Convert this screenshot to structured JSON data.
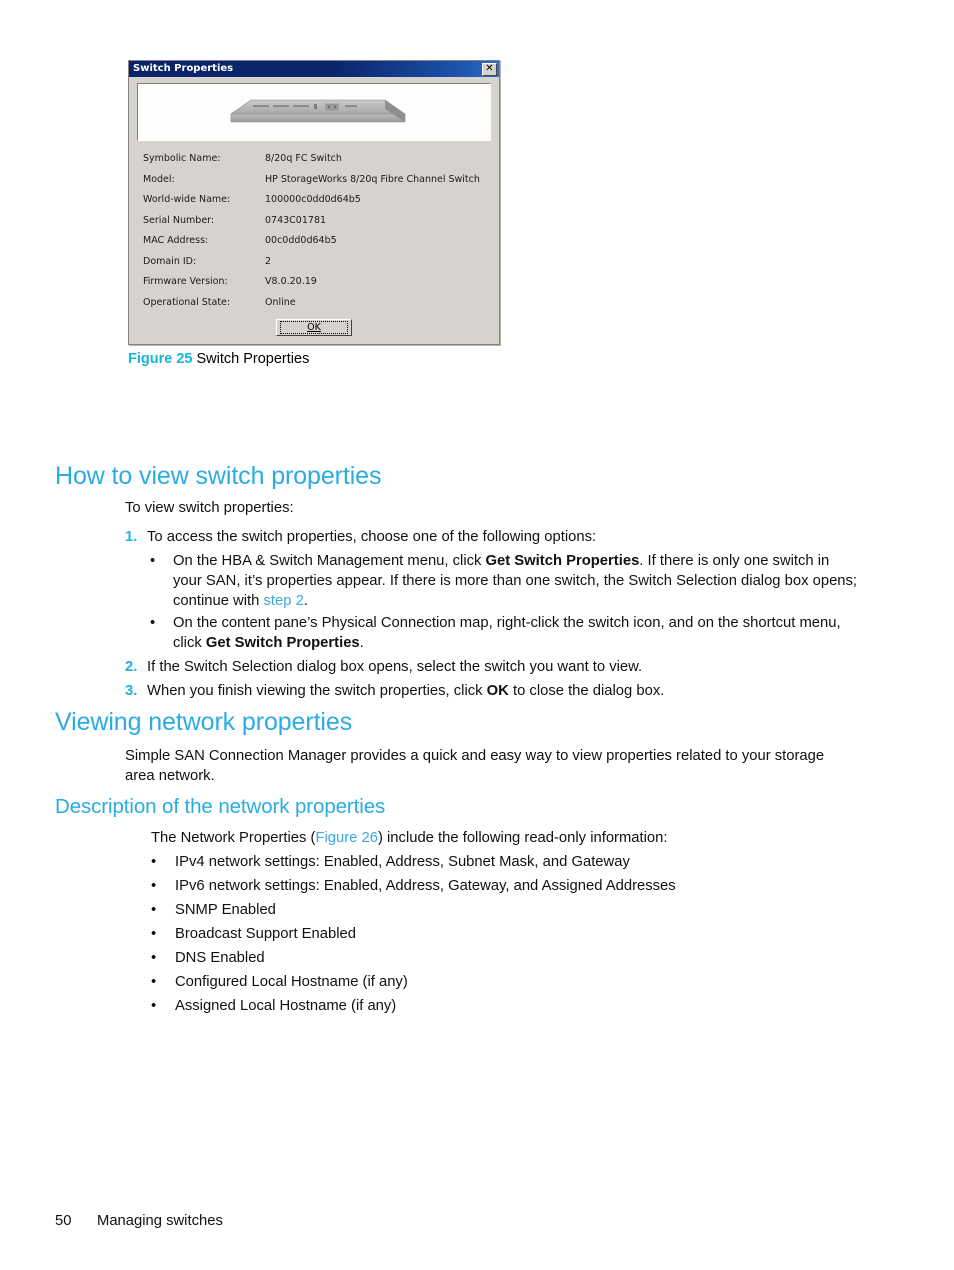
{
  "page": {
    "footer_page_number": "50",
    "footer_chapter": "Managing switches"
  },
  "colors": {
    "heading": "#2aace2",
    "link": "#3aa9e0",
    "list_number": "#21b0e0",
    "figure_label": "#19b3e0",
    "dialog_face": "#d6d3ce",
    "titlebar": "#0a246a"
  },
  "figure": {
    "label": "Figure 25",
    "caption": "Switch Properties",
    "dialog": {
      "title": "Switch Properties",
      "close_button": "✕",
      "ok_button": "OK",
      "ok_button_mnemonic": "O",
      "ok_button_rest": "K",
      "properties": [
        {
          "label": "Symbolic Name:",
          "value": "8/20q FC Switch"
        },
        {
          "label": "Model:",
          "value": "HP StorageWorks 8/20q Fibre Channel Switch"
        },
        {
          "label": "World-wide Name:",
          "value": "100000c0dd0d64b5"
        },
        {
          "label": "Serial Number:",
          "value": "0743C01781"
        },
        {
          "label": "MAC Address:",
          "value": "00c0dd0d64b5"
        },
        {
          "label": "Domain ID:",
          "value": "2"
        },
        {
          "label": "Firmware Version:",
          "value": "V8.0.20.19"
        },
        {
          "label": "Operational State:",
          "value": "Online"
        }
      ]
    }
  },
  "sections": {
    "how_to_view": {
      "heading": "How to view switch properties",
      "intro": "To view switch properties:",
      "steps": [
        {
          "number": "1.",
          "text": "To access the switch properties, choose one of the following options:",
          "sub_bullets": [
            {
              "marker": "•",
              "part1": "On the HBA & Switch Management menu, click ",
              "bold1": "Get Switch Properties",
              "part2": ". If there is only one switch in your SAN, it’s properties appear. If there is more than one switch, the Switch Selection dialog box opens; continue with ",
              "link": "step 2",
              "part3": "."
            },
            {
              "marker": "•",
              "part1": "On the content pane’s Physical Connection map, right-click the switch icon, and on the shortcut menu, click ",
              "bold1": "Get Switch Properties",
              "part2": ".",
              "link": "",
              "part3": ""
            }
          ]
        },
        {
          "number": "2.",
          "text": "If the Switch Selection dialog box opens, select the switch you want to view."
        },
        {
          "number": "3.",
          "text_before": "When you finish viewing the switch properties, click ",
          "bold": "OK",
          "text_after": " to close the dialog box."
        }
      ]
    },
    "viewing_network": {
      "heading": "Viewing network properties",
      "body": "Simple SAN Connection Manager provides a quick and easy way to view properties related to your storage area network."
    },
    "description_network": {
      "heading": "Description of the network properties",
      "intro_before": "The Network Properties (",
      "intro_link": "Figure 26",
      "intro_after": ") include the following read-only information:",
      "bullets": [
        "IPv4 network settings: Enabled, Address, Subnet Mask, and Gateway",
        "IPv6 network settings: Enabled, Address, Gateway, and Assigned Addresses",
        "SNMP Enabled",
        "Broadcast Support Enabled",
        "DNS Enabled",
        "Configured Local Hostname (if any)",
        "Assigned Local Hostname (if any)"
      ]
    }
  }
}
